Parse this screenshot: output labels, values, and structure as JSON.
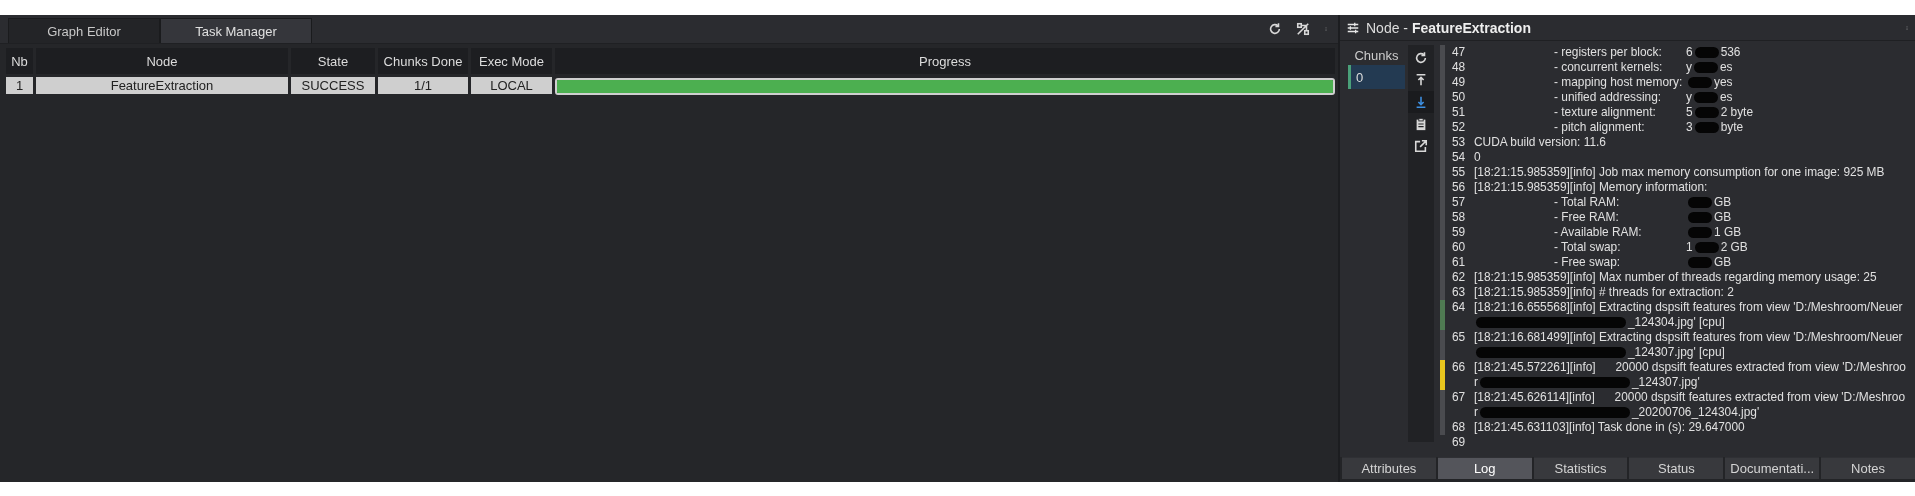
{
  "left_tabs": [
    {
      "label": "Graph Editor",
      "selected": false
    },
    {
      "label": "Task Manager",
      "selected": true
    }
  ],
  "table": {
    "columns": [
      "Nb",
      "Node",
      "State",
      "Chunks Done",
      "Exec Mode",
      "Progress"
    ],
    "rows": [
      {
        "nb": "1",
        "node": "FeatureExtraction",
        "state": "SUCCESS",
        "chunks_done": "1/1",
        "exec_mode": "LOCAL",
        "level": 1
      }
    ]
  },
  "node_panel": {
    "title_prefix": "Node - ",
    "title": "FeatureExtraction",
    "chunks": {
      "header": "Chunks",
      "items": [
        {
          "label": "0",
          "selected": true
        }
      ]
    },
    "log_tools": [
      {
        "kind": "refresh",
        "selected": false
      },
      {
        "kind": "top",
        "selected": false
      },
      {
        "kind": "bottom",
        "selected": true
      },
      {
        "kind": "clipboard",
        "selected": false
      },
      {
        "kind": "external",
        "selected": false
      }
    ],
    "log": [
      {
        "num": "47",
        "kind": "field",
        "label": "- registers per block:",
        "parts": [
          {
            "kind": "text",
            "text": "6"
          },
          {
            "kind": "redaction"
          },
          {
            "kind": "text",
            "text": "536"
          }
        ]
      },
      {
        "num": "48",
        "kind": "field",
        "label": "- concurrent kernels:",
        "parts": [
          {
            "kind": "text",
            "text": "y"
          },
          {
            "kind": "redaction"
          },
          {
            "kind": "text",
            "text": "es"
          }
        ]
      },
      {
        "num": "49",
        "kind": "field",
        "label": "- mapping host memory:",
        "parts": [
          {
            "kind": "redaction"
          },
          {
            "kind": "text",
            "text": "yes"
          }
        ]
      },
      {
        "num": "50",
        "kind": "field",
        "label": "- unified addressing:",
        "parts": [
          {
            "kind": "text",
            "text": "y"
          },
          {
            "kind": "redaction"
          },
          {
            "kind": "text",
            "text": "es"
          }
        ]
      },
      {
        "num": "51",
        "kind": "field",
        "label": "- texture alignment:",
        "parts": [
          {
            "kind": "text",
            "text": "5"
          },
          {
            "kind": "redaction"
          },
          {
            "kind": "text",
            "text": "2 byte"
          }
        ]
      },
      {
        "num": "52",
        "kind": "field",
        "label": "- pitch alignment:",
        "parts": [
          {
            "kind": "text",
            "text": "3"
          },
          {
            "kind": "redaction"
          },
          {
            "kind": "text",
            "text": "byte"
          }
        ]
      },
      {
        "num": "53",
        "kind": "message",
        "parts": [
          {
            "kind": "text",
            "text": "CUDA build version: 11.6"
          }
        ]
      },
      {
        "num": "54",
        "kind": "message",
        "parts": [
          {
            "kind": "text",
            "text": "0"
          }
        ]
      },
      {
        "num": "55",
        "kind": "message",
        "parts": [
          {
            "kind": "text",
            "text": "[18:21:15.985359][info] Job max memory consumption for one image: 925 MB"
          }
        ]
      },
      {
        "num": "56",
        "kind": "message",
        "parts": [
          {
            "kind": "text",
            "text": "[18:21:15.985359][info] Memory information:"
          }
        ]
      },
      {
        "num": "57",
        "kind": "field",
        "label": "- Total RAM:",
        "parts": [
          {
            "kind": "redaction"
          },
          {
            "kind": "text",
            "text": "GB"
          }
        ]
      },
      {
        "num": "58",
        "kind": "field",
        "label": "- Free RAM:",
        "parts": [
          {
            "kind": "redaction"
          },
          {
            "kind": "text",
            "text": "GB"
          }
        ]
      },
      {
        "num": "59",
        "kind": "field",
        "label": "- Available RAM:",
        "parts": [
          {
            "kind": "redaction"
          },
          {
            "kind": "text",
            "text": "1 GB"
          }
        ]
      },
      {
        "num": "60",
        "kind": "field",
        "label": "- Total swap:",
        "parts": [
          {
            "kind": "text",
            "text": "1"
          },
          {
            "kind": "redaction"
          },
          {
            "kind": "text",
            "text": "2 GB"
          }
        ]
      },
      {
        "num": "61",
        "kind": "field",
        "label": "- Free swap:",
        "parts": [
          {
            "kind": "redaction"
          },
          {
            "kind": "text",
            "text": "GB"
          }
        ]
      },
      {
        "num": "62",
        "kind": "message",
        "parts": [
          {
            "kind": "text",
            "text": "[18:21:15.985359][info] Max number of threads regarding memory usage: 25"
          }
        ]
      },
      {
        "num": "63",
        "kind": "message",
        "parts": [
          {
            "kind": "text",
            "text": "[18:21:15.985359][info] # threads for extraction: 2"
          }
        ]
      },
      {
        "num": "64",
        "kind": "message",
        "color": "#4f7a52",
        "parts": [
          {
            "kind": "text",
            "text": "[18:21:16.655568][info] Extracting dspsift features from view 'D:/Meshroom/Neuer"
          }
        ],
        "wrap": [
          {
            "kind": "redaction"
          },
          {
            "kind": "text",
            "text": "_124304.jpg' [cpu]"
          }
        ]
      },
      {
        "num": "65",
        "kind": "message",
        "parts": [
          {
            "kind": "text",
            "text": "[18:21:16.681499][info] Extracting dspsift features from view 'D:/Meshroom/Neuer"
          }
        ],
        "wrap": [
          {
            "kind": "redaction"
          },
          {
            "kind": "text",
            "text": "_124307.jpg' [cpu]"
          }
        ]
      },
      {
        "num": "66",
        "kind": "message",
        "color": "#e8c51e",
        "parts": [
          {
            "kind": "text",
            "text": "[18:21:45.572261][info]      20000 dspsift features extracted from view 'D:/Meshroo"
          }
        ],
        "wrap": [
          {
            "kind": "text",
            "text": "r"
          },
          {
            "kind": "redaction"
          },
          {
            "kind": "text",
            "text": "_124307.jpg'"
          }
        ]
      },
      {
        "num": "67",
        "kind": "message",
        "parts": [
          {
            "kind": "text",
            "text": "[18:21:45.626114][info]      20000 dspsift features extracted from view 'D:/Meshroo"
          }
        ],
        "wrap": [
          {
            "kind": "text",
            "text": "r"
          },
          {
            "kind": "redaction"
          },
          {
            "kind": "text",
            "text": "_20200706_124304.jpg'"
          }
        ]
      },
      {
        "num": "68",
        "kind": "message",
        "parts": [
          {
            "kind": "text",
            "text": "[18:21:45.631103][info] Task done in (s): 29.647000"
          }
        ]
      },
      {
        "num": "69",
        "kind": "message"
      }
    ],
    "bottom_tabs": [
      {
        "label": "Attributes",
        "selected": false
      },
      {
        "label": "Log",
        "selected": true
      },
      {
        "label": "Statistics",
        "selected": false
      },
      {
        "label": "Status",
        "selected": false
      },
      {
        "label": "Documentati...",
        "selected": false
      },
      {
        "label": "Notes",
        "selected": false
      }
    ]
  }
}
